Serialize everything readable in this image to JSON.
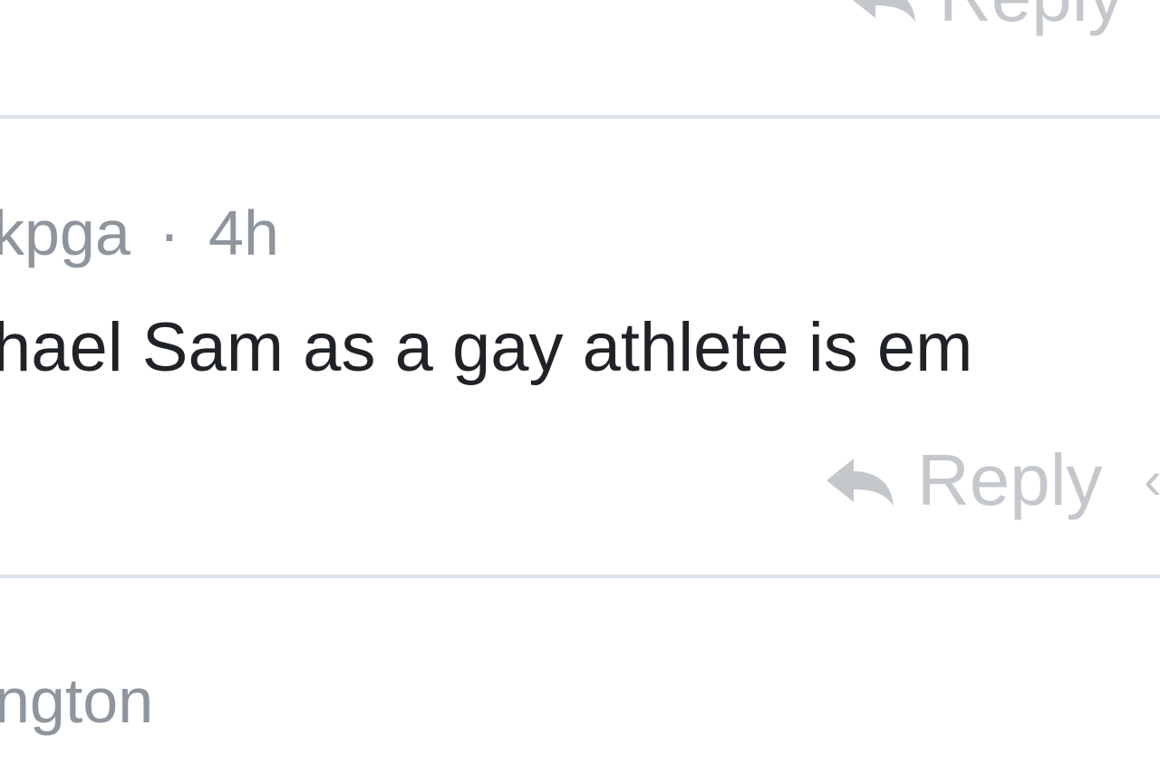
{
  "comments": [
    {
      "reply_label": "Reply"
    },
    {
      "author": "kpga",
      "separator": "·",
      "time": "4h",
      "body": "hael Sam as a gay athlete is em",
      "reply_label": "Reply"
    },
    {
      "author": "ngton"
    }
  ],
  "icons": {
    "reply": "reply-arrow-icon",
    "more": "more-icon"
  },
  "colors": {
    "divider": "#dde3ea",
    "meta_text": "#8e959c",
    "body_text": "#1f2226",
    "action_text": "#c4c8cc"
  }
}
